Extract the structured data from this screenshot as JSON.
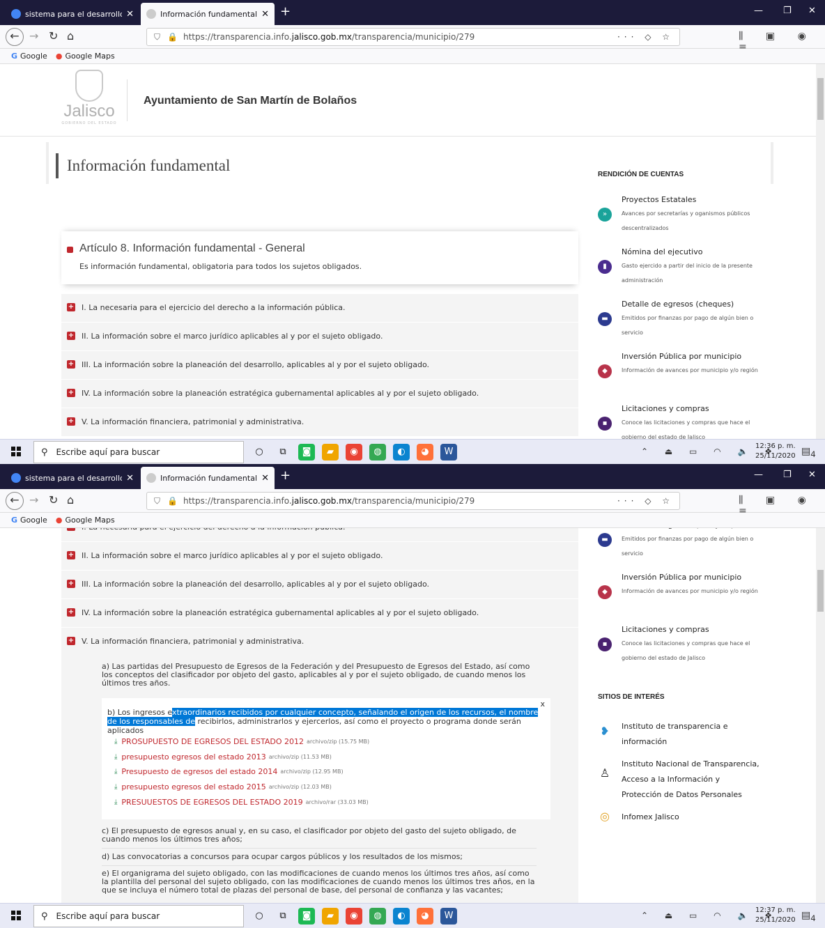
{
  "browser": {
    "tabs": [
      {
        "title": "sistema para el desarrollo integ",
        "close": "✕"
      },
      {
        "title": "Información fundamental | Por",
        "close": "✕"
      }
    ],
    "new_tab": "+",
    "window_buttons": {
      "minimize": "—",
      "maximize": "❐",
      "close": "✕"
    },
    "url_prefix": "https://transparencia.info.",
    "url_host": "jalisco.gob.mx",
    "url_path": "/transparencia/municipio/279",
    "page_actions": "··· ◇ ☆",
    "toolbar_icons": "⫼ ▣ ◉ ≡",
    "bookmarks": [
      {
        "icon": "G",
        "label": "Google"
      },
      {
        "icon": "●",
        "label": "Google Maps"
      }
    ]
  },
  "site": {
    "logo_word": "Jalisco",
    "logo_sub": "GOBIERNO DEL ESTADO",
    "title": "Ayuntamiento de San Martín de Bolaños",
    "page_heading": "Información fundamental"
  },
  "article": {
    "title": "Artículo 8. Información fundamental - General",
    "desc": "Es información fundamental, obligatoria para todos los sujetos obligados."
  },
  "fractions": [
    "I. La necesaria para el ejercicio del derecho a la información pública.",
    "II. La información sobre el marco jurídico aplicables al y por el sujeto obligado.",
    "III. La información sobre la planeación del desarrollo, aplicables al y por el sujeto obligado.",
    "IV. La información sobre la planeación estratégica gubernamental aplicables al y por el sujeto obligado.",
    "V. La información financiera, patrimonial y administrativa."
  ],
  "fraction_v": {
    "a": "a) Las partidas del Presupuesto de Egresos de la Federación y del Presupuesto de Egresos del Estado, así como los conceptos del clasificador por objeto del gasto, aplicables al y por el sujeto obligado, de cuando menos los últimos tres años.",
    "b_pre": "b) Los ingresos e",
    "b_hl": "xtraordinarios recibidos por cualquier concepto, señalando el origen de los recursos, el nombre de los responsables de",
    "b_post": " recibirlos, administrarlos y ejercerlos, así como el proyecto o programa donde serán aplicados",
    "popup_close": "x",
    "downloads": [
      {
        "name": "PROSUPUESTO DE EGRESOS DEL ESTADO 2012",
        "meta": "archivo/zip (15.75 MB)"
      },
      {
        "name": "presupuesto egresos del estado 2013",
        "meta": "archivo/zip (11.53 MB)"
      },
      {
        "name": "Presupuesto de egresos del estado 2014",
        "meta": "archivo/zip (12.95 MB)"
      },
      {
        "name": "presupuesto egresos del estado 2015",
        "meta": "archivo/zip (12.03 MB)"
      },
      {
        "name": "PRESUUESTOS DE EGRESOS DEL ESTADO 2019",
        "meta": "archivo/rar (33.03 MB)"
      }
    ],
    "c": "c) El presupuesto de egresos anual y, en su caso, el clasificador por objeto del gasto del sujeto obligado, de cuando menos los últimos tres años;",
    "d": "d) Las convocatorias a concursos para ocupar cargos públicos y los resultados de los mismos;",
    "e": "e) El organigrama del sujeto obligado, con las modificaciones de cuando menos los últimos tres años, así como la plantilla del personal del sujeto obligado, con las modificaciones de cuando menos los últimos tres años, en la que se incluya el número total de plazas del personal de base, del personal de confianza y las vacantes;"
  },
  "sidebar": {
    "rendicion_heading": "RENDICIÓN DE CUENTAS",
    "items": [
      {
        "title": "Proyectos Estatales",
        "desc": "Avances por secretarías y oganismos públicos descentralizados",
        "color": "#1aa39a",
        "icon": "»"
      },
      {
        "title": "Nómina del ejecutivo",
        "desc": "Gasto ejercido a partir del inicio de la presente administración",
        "color": "#4a2c8f",
        "icon": "▮"
      },
      {
        "title": "Detalle de egresos (cheques)",
        "desc": "Emitidos por finanzas por pago de algún bien o servicio",
        "color": "#2c3a8f",
        "icon": "▬"
      },
      {
        "title": "Inversión Pública por municipio",
        "desc": "Información de avances por municipio y/o región",
        "color": "#b8334a",
        "icon": "◆"
      },
      {
        "title": "Licitaciones y compras",
        "desc": "Conoce las licitaciones y compras que hace el gobierno del estado de Jalisco",
        "color": "#4a2270",
        "icon": "▪"
      }
    ],
    "sitios_heading": "SITIOS DE INTERÉS",
    "sites": [
      {
        "text": "Instituto de transparencia e información",
        "icon": "❥"
      },
      {
        "text": "Instituto Nacional de Transparencia, Acceso a la Información y Protección de Datos Personales",
        "icon": "♙"
      },
      {
        "text": "Infomex Jalisco",
        "icon": "◎"
      }
    ]
  },
  "taskbar": {
    "search_placeholder": "Escribe aquí para buscar",
    "apps": [
      {
        "icon": "○",
        "color": "transparent"
      },
      {
        "icon": "⧉",
        "color": "transparent"
      },
      {
        "icon": "◙",
        "color": "#1db954"
      },
      {
        "icon": "▰",
        "color": "#f0a500"
      },
      {
        "icon": "◉",
        "color": "#ea4335"
      },
      {
        "icon": "◍",
        "color": "#34a853"
      },
      {
        "icon": "◐",
        "color": "#0a84d0"
      },
      {
        "icon": "◕",
        "color": "#ff7139"
      },
      {
        "icon": "W",
        "color": "#2b579a"
      }
    ],
    "tray": "⌃ ⏏ ▭ ◠ 🔈 ❖",
    "shot1_time": "12:36 p. m.",
    "shot2_time": "12:37 p. m.",
    "date": "25/11/2020",
    "notif": "4"
  }
}
